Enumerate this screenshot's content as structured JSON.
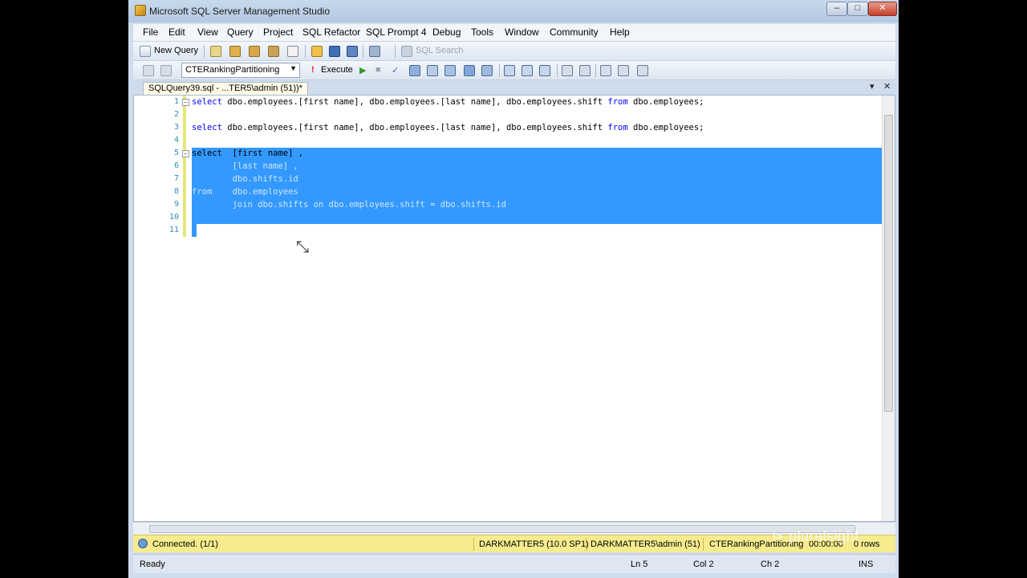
{
  "window": {
    "title": "Microsoft SQL Server Management Studio"
  },
  "menu": [
    "File",
    "Edit",
    "View",
    "Query",
    "Project",
    "SQL Refactor",
    "SQL Prompt 4",
    "Debug",
    "Tools",
    "Window",
    "Community",
    "Help"
  ],
  "toolbar1": {
    "new_query": "New Query",
    "sql_search": "SQL Search"
  },
  "toolbar2": {
    "database": "CTERankingPartitioning",
    "execute": "Execute"
  },
  "tab": {
    "label": "SQLQuery39.sql - ...TER5\\admin (51))*"
  },
  "editor": {
    "line_numbers": [
      "1",
      "2",
      "3",
      "4",
      "5",
      "6",
      "7",
      "8",
      "9",
      "10",
      "11"
    ],
    "lines": [
      "select dbo.employees.[first name], dbo.employees.[last name], dbo.employees.shift from dbo.employees;",
      "",
      "select dbo.employees.[first name], dbo.employees.[last name], dbo.employees.shift from dbo.employees;",
      "",
      "select  [first name] ,",
      "        [last name] ,",
      "        dbo.shifts.id",
      "from    dbo.employees",
      "        join dbo.shifts on dbo.employees.shift = dbo.shifts.id",
      "",
      ""
    ]
  },
  "connection": {
    "status": "Connected. (1/1)",
    "server": "DARKMATTER5 (10.0 SP1)",
    "user": "DARKMATTER5\\admin (51)",
    "database": "CTERankingPartitioning",
    "time": "00:00:00",
    "rows": "0 rows"
  },
  "status": {
    "ready": "Ready",
    "ln": "Ln 5",
    "col": "Col 2",
    "ch": "Ch 2",
    "ins": "INS"
  },
  "watermark": "pluralsight"
}
